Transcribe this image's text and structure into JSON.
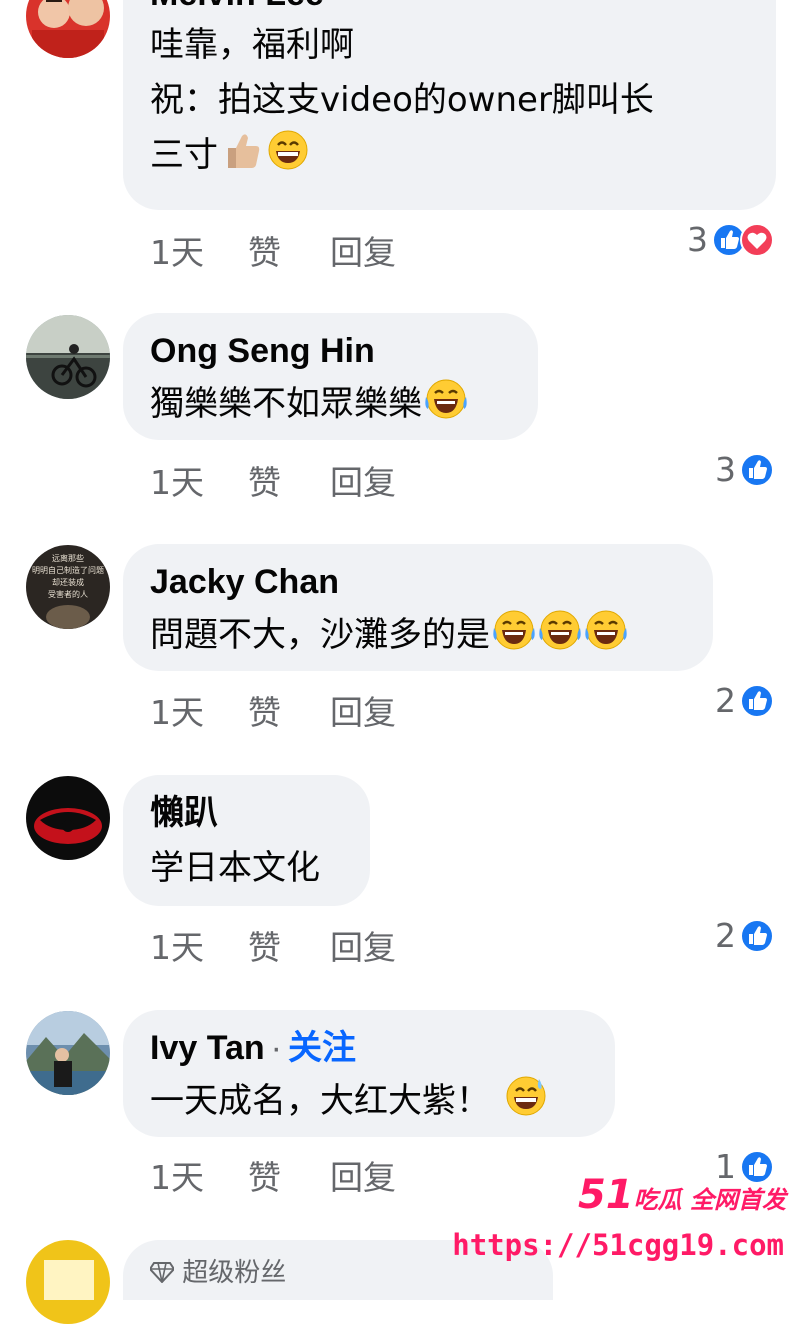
{
  "comments": [
    {
      "name": "Melvin Lee",
      "lines": [
        "哇靠，福利啊",
        "祝：拍这支video的owner脚叫长",
        "三寸"
      ],
      "time": "1天",
      "like": "赞",
      "reply": "回复",
      "reaction_count": "3",
      "reactions": [
        "like-icon",
        "love-icon"
      ]
    },
    {
      "name": "Ong Seng Hin",
      "lines": [
        "獨樂樂不如眾樂樂"
      ],
      "time": "1天",
      "like": "赞",
      "reply": "回复",
      "reaction_count": "3",
      "reactions": [
        "like-icon"
      ]
    },
    {
      "name": "Jacky Chan",
      "lines": [
        "問題不大，沙灘多的是"
      ],
      "time": "1天",
      "like": "赞",
      "reply": "回复",
      "reaction_count": "2",
      "reactions": [
        "like-icon"
      ]
    },
    {
      "name": "懶趴",
      "lines": [
        "学日本文化"
      ],
      "time": "1天",
      "like": "赞",
      "reply": "回复",
      "reaction_count": "2",
      "reactions": [
        "like-icon"
      ]
    },
    {
      "name": "Ivy Tan",
      "follow_dot": "·",
      "follow": "关注",
      "lines": [
        "一天成名，大红大紫！"
      ],
      "time": "1天",
      "like": "赞",
      "reply": "回复",
      "reaction_count": "1",
      "reactions": [
        "like-icon"
      ]
    }
  ],
  "avatar_texts": {
    "jacky": [
      "远离那些",
      "明明自己制造了问题",
      "却还装成",
      "受害者的人"
    ]
  },
  "superfan": {
    "label": "超级粉丝",
    "icon": "diamond-icon"
  },
  "watermark": {
    "brand_num": "51",
    "brand_text": "吃瓜 全网首发",
    "url": "https://51cgg19.com"
  },
  "colors": {
    "bubble": "#f0f2f5",
    "meta": "#65676b",
    "link": "#0866ff",
    "like": "#1877f2",
    "love": "#f33e58",
    "watermark": "#ff1a66"
  }
}
